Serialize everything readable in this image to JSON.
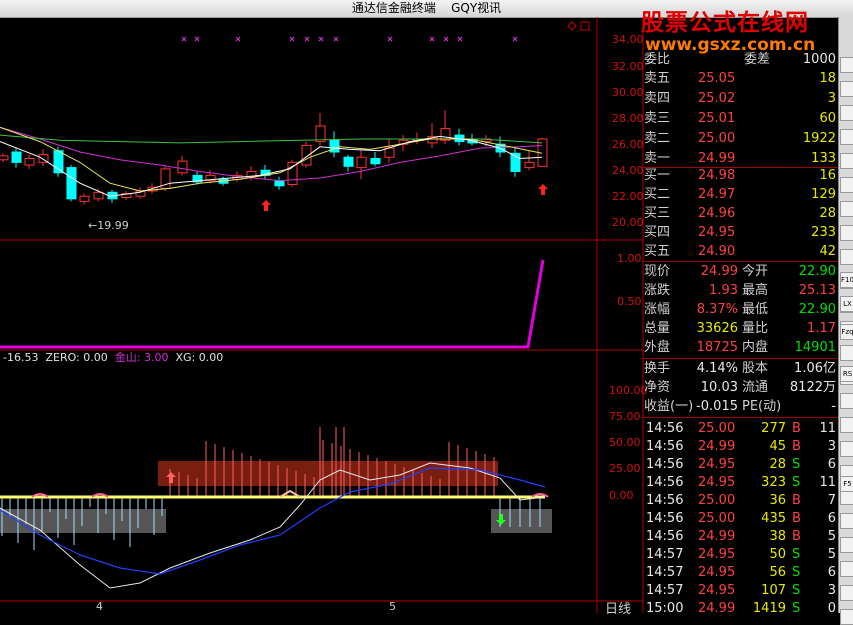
{
  "window": {
    "title": "通达信金融终端    GQY视讯"
  },
  "watermark": {
    "main": "股票公式在线网",
    "url": "www.gsxz.com.cn"
  },
  "price_chart": {
    "y_ticks": [
      "34.00",
      "32.00",
      "30.00",
      "28.00",
      "26.00",
      "24.00",
      "22.00",
      "20.00"
    ],
    "low_label": "←19.99"
  },
  "indicator2": {
    "y_ticks": [
      "1.00",
      "0.50"
    ]
  },
  "indicator3": {
    "header": [
      {
        "text": "-16.53",
        "color": "#e0e0e0"
      },
      {
        "text": "ZERO: 0.00",
        "color": "#e0e0e0"
      },
      {
        "text": "金山: 3.00",
        "color": "#d030d0"
      },
      {
        "text": "XG: 0.00",
        "color": "#e0e0e0"
      }
    ],
    "y_ticks": [
      "100.00",
      "75.00",
      "50.00",
      "25.00",
      "0.00"
    ]
  },
  "x_axis": {
    "labels": [
      "4",
      "5"
    ],
    "period_label": "日线"
  },
  "order_book": {
    "partial_row": {
      "label": "委比",
      "value": "",
      "label2": "委差",
      "value2": "1000"
    },
    "asks": [
      {
        "label": "卖五",
        "price": "25.05",
        "volume": "18"
      },
      {
        "label": "卖四",
        "price": "25.02",
        "volume": "3"
      },
      {
        "label": "卖三",
        "price": "25.01",
        "volume": "60"
      },
      {
        "label": "卖二",
        "price": "25.00",
        "volume": "1922"
      },
      {
        "label": "卖一",
        "price": "24.99",
        "volume": "133"
      }
    ],
    "bids": [
      {
        "label": "买一",
        "price": "24.98",
        "volume": "16"
      },
      {
        "label": "买二",
        "price": "24.97",
        "volume": "129"
      },
      {
        "label": "买三",
        "price": "24.96",
        "volume": "28"
      },
      {
        "label": "买四",
        "price": "24.95",
        "volume": "233"
      },
      {
        "label": "买五",
        "price": "24.90",
        "volume": "42"
      }
    ]
  },
  "quote_stats": [
    {
      "l1": "现价",
      "v1": "24.99",
      "c1": "r",
      "l2": "今开",
      "v2": "22.90",
      "c2": "g"
    },
    {
      "l1": "涨跌",
      "v1": "1.93",
      "c1": "r",
      "l2": "最高",
      "v2": "25.13",
      "c2": "r"
    },
    {
      "l1": "涨幅",
      "v1": "8.37%",
      "c1": "r",
      "l2": "最低",
      "v2": "22.90",
      "c2": "g"
    },
    {
      "l1": "总量",
      "v1": "33626",
      "c1": "y",
      "l2": "量比",
      "v2": "1.17",
      "c2": "r"
    },
    {
      "l1": "外盘",
      "v1": "18725",
      "c1": "r",
      "l2": "内盘",
      "v2": "14901",
      "c2": "g"
    }
  ],
  "fundamentals": [
    {
      "l1": "换手",
      "v1": "4.14%",
      "l2": "股本",
      "v2": "1.06亿"
    },
    {
      "l1": "净资",
      "v1": "10.03",
      "l2": "流通",
      "v2": "8122万"
    },
    {
      "l1": "收益(一)",
      "v1": "-0.015",
      "l2": "PE(动)",
      "v2": "-"
    }
  ],
  "trades": [
    {
      "time": "14:56",
      "price": "25.00",
      "vol": "277",
      "side": "B",
      "count": "11"
    },
    {
      "time": "14:56",
      "price": "24.99",
      "vol": "45",
      "side": "B",
      "count": "3"
    },
    {
      "time": "14:56",
      "price": "24.95",
      "vol": "28",
      "side": "S",
      "count": "6"
    },
    {
      "time": "14:56",
      "price": "24.95",
      "vol": "323",
      "side": "S",
      "count": "11"
    },
    {
      "time": "14:56",
      "price": "25.00",
      "vol": "36",
      "side": "B",
      "count": "7"
    },
    {
      "time": "14:56",
      "price": "25.00",
      "vol": "435",
      "side": "B",
      "count": "6"
    },
    {
      "time": "14:56",
      "price": "24.99",
      "vol": "38",
      "side": "B",
      "count": "5"
    },
    {
      "time": "14:57",
      "price": "24.95",
      "vol": "50",
      "side": "S",
      "count": "5"
    },
    {
      "time": "14:57",
      "price": "24.95",
      "vol": "56",
      "side": "S",
      "count": "6"
    },
    {
      "time": "14:57",
      "price": "24.95",
      "vol": "107",
      "side": "S",
      "count": "3"
    },
    {
      "time": "15:00",
      "price": "24.99",
      "vol": "1419",
      "side": "S",
      "count": "0"
    }
  ],
  "toolbar_icons": [
    "F10",
    "LX",
    "Fzq",
    "F5",
    "RS"
  ],
  "colors": {
    "up": "#ff3232",
    "down": "#00ffff",
    "purple_line": "#d030d0",
    "axis": "#b00000"
  }
}
